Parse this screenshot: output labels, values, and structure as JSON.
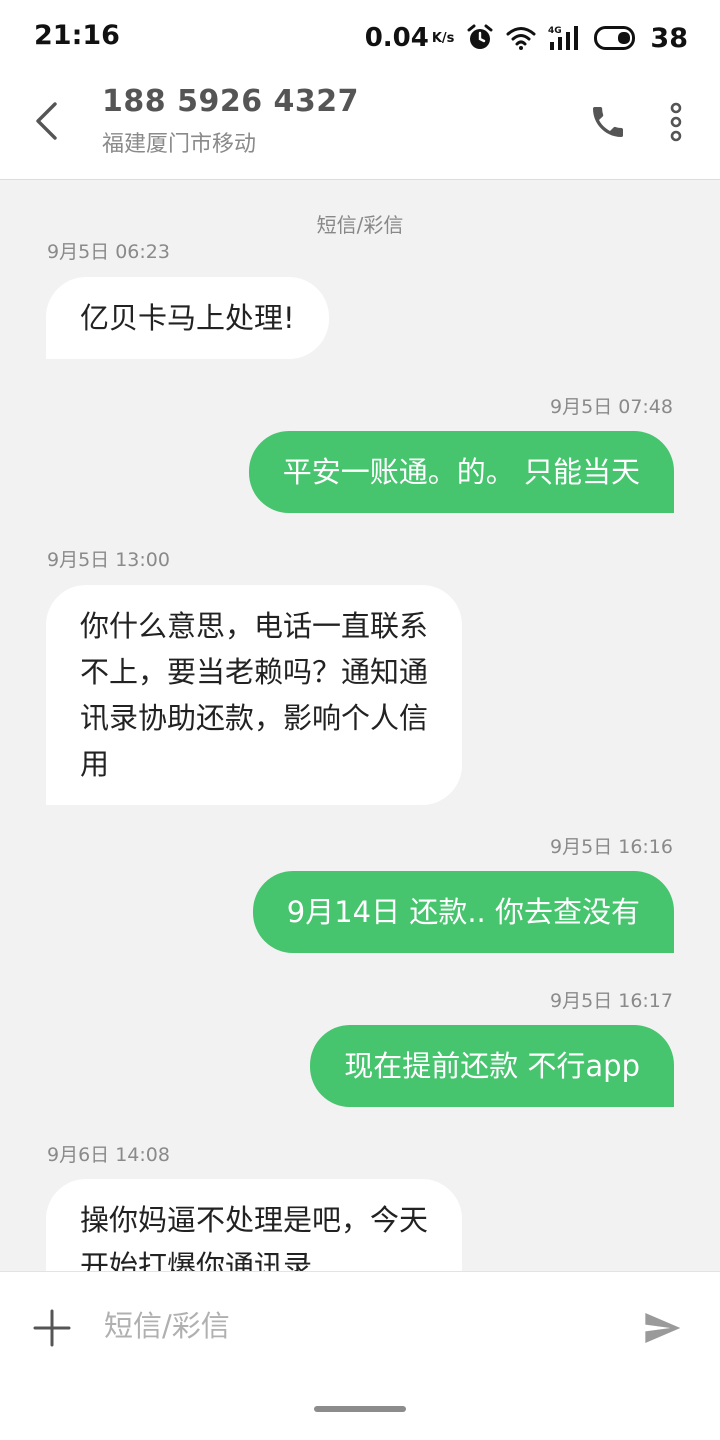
{
  "status_bar": {
    "time": "21:16",
    "net_speed": "0.04",
    "net_speed_unit": "K/s",
    "network": "4G",
    "battery": "38",
    "icons": [
      "alarm-icon",
      "wifi-icon",
      "signal-4g-icon",
      "battery-icon"
    ]
  },
  "header": {
    "contact_number": "188 5926 4327",
    "contact_location": "福建厦门市移动"
  },
  "conversation": {
    "channel_label": "短信/彩信",
    "messages": [
      {
        "direction": "in",
        "time": "9月5日 06:23",
        "lines": [
          "亿贝卡马上处理!"
        ]
      },
      {
        "direction": "out",
        "time": "9月5日 07:48",
        "lines": [
          "平安一账通。的。 只能当天"
        ]
      },
      {
        "direction": "in",
        "time": "9月5日 13:00",
        "lines": [
          "你什么意思，电话一直联系",
          "不上，要当老赖吗？通知通",
          "讯录协助还款，影响个人信",
          "用"
        ]
      },
      {
        "direction": "out",
        "time": "9月5日 16:16",
        "lines": [
          "9月14日 还款.. 你去查没有"
        ]
      },
      {
        "direction": "out",
        "time": "9月5日 16:17",
        "lines": [
          "现在提前还款 不行app"
        ]
      },
      {
        "direction": "in",
        "time": "9月6日 14:08",
        "lines": [
          " 操你妈逼不处理是吧，今天",
          "开始打爆你通讯录"
        ]
      }
    ]
  },
  "composer": {
    "placeholder": "短信/彩信"
  },
  "colors": {
    "outgoing_bubble": "#46c46e",
    "incoming_bubble": "#ffffff",
    "background": "#f2f2f2"
  }
}
